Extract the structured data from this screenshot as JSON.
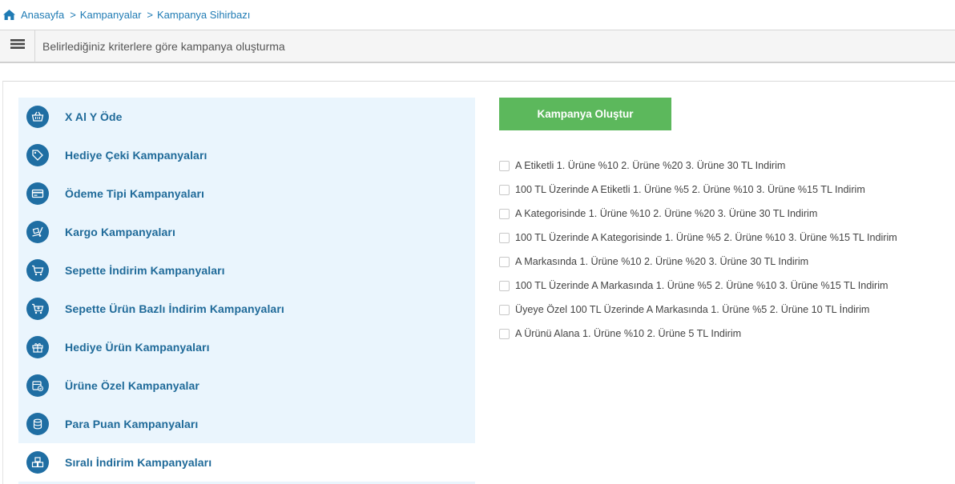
{
  "breadcrumb": {
    "home": "Anasayfa",
    "items": [
      "Kampanyalar",
      "Kampanya Sihirbazı"
    ],
    "separator": ">"
  },
  "header": {
    "description": "Belirlediğiniz kriterlere göre kampanya oluşturma"
  },
  "campaign_types": [
    {
      "label": "X Al Y Öde",
      "icon": "basket-icon"
    },
    {
      "label": "Hediye Çeki Kampanyaları",
      "icon": "tag-icon"
    },
    {
      "label": "Ödeme Tipi Kampanyaları",
      "icon": "credit-card-icon"
    },
    {
      "label": "Kargo Kampanyaları",
      "icon": "cargo-dolly-icon"
    },
    {
      "label": "Sepette İndirim Kampanyaları",
      "icon": "cart-icon"
    },
    {
      "label": "Sepette Ürün Bazlı İndirim Kampanyaları",
      "icon": "cart-plus-icon"
    },
    {
      "label": "Hediye Ürün Kampanyaları",
      "icon": "gift-icon"
    },
    {
      "label": "Ürüne Özel Kampanyalar",
      "icon": "product-badge-icon"
    },
    {
      "label": "Para Puan Kampanyaları",
      "icon": "coins-icon"
    },
    {
      "label": "Sıralı İndirim Kampanyaları",
      "icon": "stacked-boxes-icon"
    }
  ],
  "create_button": "Kampanya Oluştur",
  "options": [
    "A Etiketli 1. Ürüne %10 2. Ürüne %20 3. Ürüne 30 TL Indirim",
    "100 TL Üzerinde A Etiketli 1. Ürüne %5 2. Ürüne %10 3. Ürüne %15 TL Indirim",
    "A Kategorisinde 1. Ürüne %10 2. Ürüne %20 3. Ürüne 30 TL Indirim",
    "100 TL Üzerinde A Kategorisinde 1. Ürüne %5 2. Ürüne %10 3. Ürüne %15 TL Indirim",
    "A Markasında 1. Ürüne %10 2. Ürüne %20 3. Ürüne 30 TL Indirim",
    "100 TL Üzerinde A Markasında 1. Ürüne %5 2. Ürüne %10 3. Ürüne %15 TL Indirim",
    "Üyeye Özel 100 TL Üzerinde A Markasında 1. Ürüne %5 2. Ürüne 10 TL İndirim",
    "A Ürünü Alana 1. Ürüne %10 2. Ürüne 5 TL Indirim"
  ],
  "colors": {
    "link": "#1f7bb4",
    "list_bg": "#eaf5fd",
    "icon_bg": "#1f6ea3",
    "label": "#1f6a99",
    "button": "#5cb85c"
  }
}
